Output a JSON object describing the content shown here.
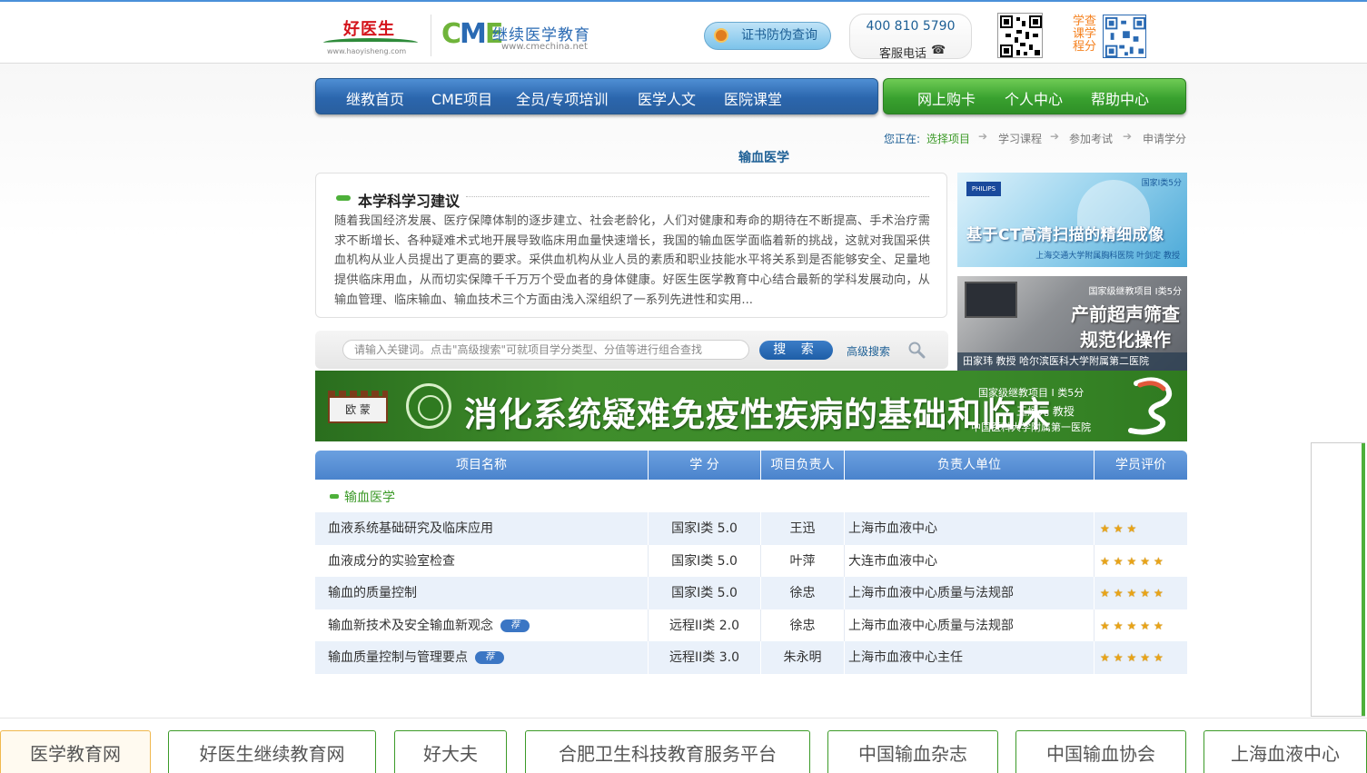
{
  "header": {
    "brand_cn": "好医生",
    "brand_url": "www.haoyisheng.com",
    "cme_mark": [
      "C",
      "M",
      "E"
    ],
    "cme_title": "继续医学教育",
    "cme_url": "www.cmechina.net",
    "cert_button": "证书防伪查询",
    "phone": "400 810 5790",
    "phone_label": "客服电话",
    "qr_label": [
      "学查",
      "课学",
      "程分"
    ]
  },
  "nav": {
    "blue": [
      "继教首页",
      "CME项目",
      "全员/专项培训",
      "医学人文",
      "医院课堂"
    ],
    "green": [
      "网上购卡",
      "个人中心",
      "帮助中心"
    ]
  },
  "breadcrumb": {
    "lead": "您正在:",
    "steps": [
      "选择项目",
      "学习课程",
      "参加考试",
      "申请学分"
    ]
  },
  "page_title": "输血医学",
  "advice": {
    "heading": "本学科学习建议",
    "body": "随着我国经济发展、医疗保障体制的逐步建立、社会老龄化，人们对健康和寿命的期待在不断提高、手术治疗需求不断增长、各种疑难术式地开展导致临床用血量快速增长，我国的输血医学面临着新的挑战，这就对我国采供血机构从业人员提出了更高的要求。采供血机构从业人员的素质和职业技能水平将关系到是否能够安全、足量地提供临床用血，从而切实保障千千万万个受血者的身体健康。好医生医学教育中心结合最新的学科发展动向，从输血管理、临床输血、输血技术三个方面由浅入深组织了一系列先进性和实用..."
  },
  "side_ads": [
    {
      "badge": "国家I类5分",
      "brand": "PHILIPS",
      "title": "基于CT高清扫描的精细成像",
      "sub": "上海交通大学附属胸科医院 叶剑定 教授"
    },
    {
      "badge": "国家级继教项目 I类5分",
      "line1": "产前超声筛查",
      "line2": "规范化操作",
      "foot": "田家玮 教授  哈尔滨医科大学附属第二医院"
    }
  ],
  "search": {
    "placeholder": "请输入关键词。点击\"高级搜索\"可就项目学分类型、分值等进行组合查找",
    "button": "搜 索",
    "advanced": "高级搜索"
  },
  "banner": {
    "logo_text": "欧 蒙",
    "title": "消化系统疑难免疫性疾病的基础和临床",
    "r1": "国家级继教项目 I 类5分",
    "r2": "王炳元 教授",
    "r3": "中国医科大学附属第一医院"
  },
  "table": {
    "headers": [
      "项目名称",
      "学 分",
      "项目负责人",
      "负责人单位",
      "学员评价"
    ],
    "category": "输血医学",
    "rec_label": "荐",
    "rows": [
      {
        "name": "血液系统基础研究及临床应用",
        "credit": "国家I类 5.0",
        "lead": "王迅",
        "unit": "上海市血液中心",
        "rating": 3,
        "stars": "★★★",
        "recommended": false
      },
      {
        "name": "血液成分的实验室检查",
        "credit": "国家I类 5.0",
        "lead": "叶萍",
        "unit": "大连市血液中心",
        "rating": 5,
        "stars": "★★★★★",
        "recommended": false
      },
      {
        "name": "输血的质量控制",
        "credit": "国家I类 5.0",
        "lead": "徐忠",
        "unit": "上海市血液中心质量与法规部",
        "rating": 5,
        "stars": "★★★★★",
        "recommended": false
      },
      {
        "name": "输血新技术及安全输血新观念",
        "credit": "远程II类 2.0",
        "lead": "徐忠",
        "unit": "上海市血液中心质量与法规部",
        "rating": 5,
        "stars": "★★★★★",
        "recommended": true
      },
      {
        "name": "输血质量控制与管理要点",
        "credit": "远程II类 3.0",
        "lead": "朱永明",
        "unit": "上海市血液中心主任",
        "rating": 5,
        "stars": "★★★★★",
        "recommended": true
      }
    ]
  },
  "footer_links": [
    "医学教育网",
    "好医生继续教育网",
    "好大夫",
    "合肥卫生科技教育服务平台",
    "中国输血杂志",
    "中国输血协会",
    "上海血液中心"
  ],
  "colors": {
    "nav_blue": "#2b66ad",
    "nav_green": "#39a12f",
    "accent_green": "#3c9a28",
    "link_blue": "#1d5f95",
    "star": "#e8a317"
  },
  "icons": [
    "medal-icon",
    "phone-icon",
    "qr-code-icon",
    "search-icon",
    "arrow-right-icon",
    "recommend-badge-icon",
    "star-icon"
  ]
}
